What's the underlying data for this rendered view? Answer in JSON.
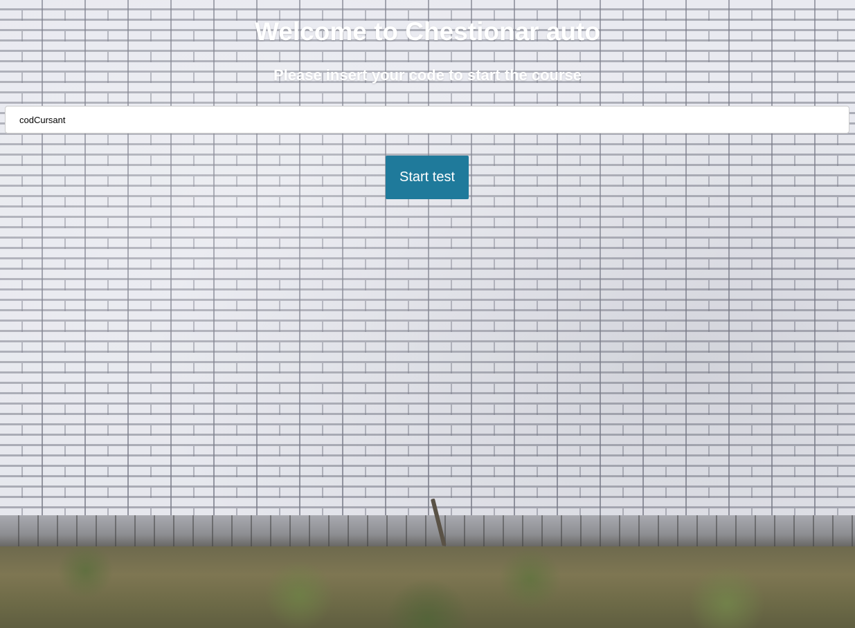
{
  "page": {
    "title": "Welcome to Chestionar auto",
    "subtitle": "Please insert your code to start the course"
  },
  "form": {
    "code_input": {
      "placeholder": "codCursant",
      "value": ""
    },
    "start_button_label": "Start test"
  },
  "colors": {
    "button_background": "#1f7a9b",
    "heading_text": "#ffffff",
    "input_background": "#ffffff"
  },
  "background": {
    "description_icon": "brick-wall-background"
  }
}
